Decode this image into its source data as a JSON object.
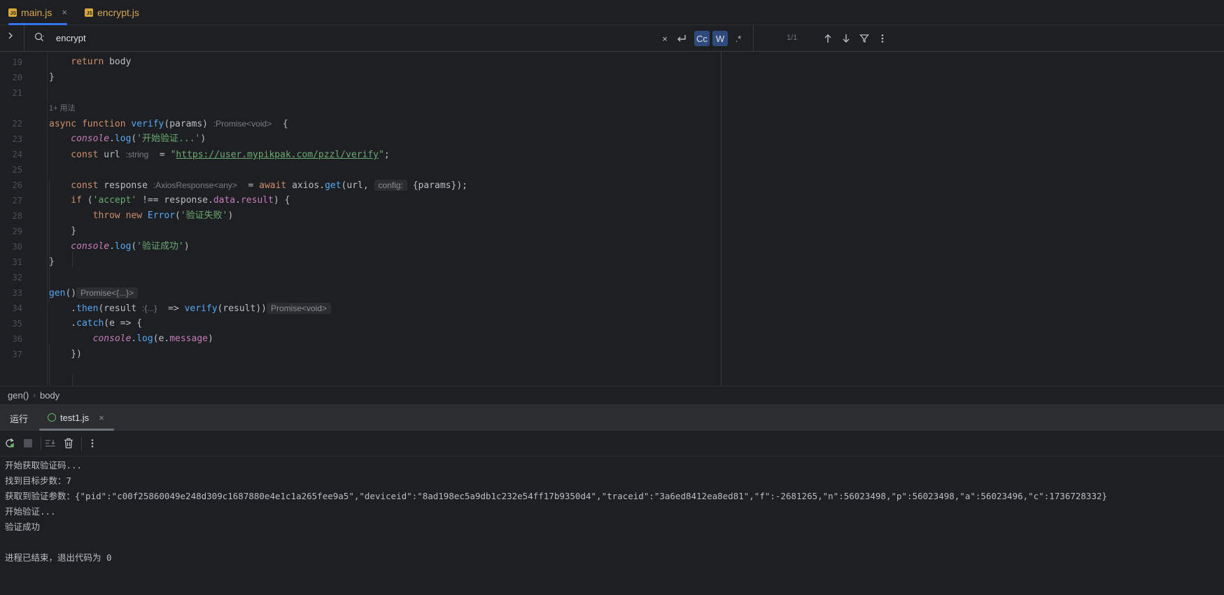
{
  "tabs": [
    {
      "label": "main.js",
      "badge": "JS",
      "close": "×"
    },
    {
      "label": "encrypt.js",
      "badge": "JS"
    }
  ],
  "find": {
    "query": "encrypt",
    "close": "×",
    "match_case_label": "Cc",
    "whole_words_label": "W",
    "regex_label": ".*",
    "match_count": "1/1"
  },
  "editor": {
    "lines": [
      {
        "n": "19",
        "segs": [
          {
            "c": "kw",
            "t": "    return "
          },
          {
            "c": "",
            "t": "body"
          }
        ]
      },
      {
        "n": "20",
        "segs": [
          {
            "c": "",
            "t": "}"
          }
        ]
      },
      {
        "n": "21",
        "segs": []
      },
      {
        "n": "",
        "usage": "1+ 用法"
      },
      {
        "n": "22",
        "segs": [
          {
            "c": "kw",
            "t": "async function "
          },
          {
            "c": "fn",
            "t": "verify"
          },
          {
            "c": "",
            "t": "(params) "
          },
          {
            "c": "hint",
            "t": ":Promise<void>"
          },
          {
            "c": "",
            "t": "  {"
          }
        ]
      },
      {
        "n": "23",
        "segs": [
          {
            "c": "it",
            "t": "    console"
          },
          {
            "c": "",
            "t": "."
          },
          {
            "c": "fn",
            "t": "log"
          },
          {
            "c": "",
            "t": "("
          },
          {
            "c": "str",
            "t": "'开始验证...'"
          },
          {
            "c": "",
            "t": ")"
          }
        ]
      },
      {
        "n": "24",
        "segs": [
          {
            "c": "kw",
            "t": "    const "
          },
          {
            "c": "",
            "t": "url "
          },
          {
            "c": "hint",
            "t": ":string"
          },
          {
            "c": "",
            "t": "  = "
          },
          {
            "c": "str",
            "t": "\""
          },
          {
            "c": "url",
            "t": "https://user.mypikpak.com/pzzl/verify"
          },
          {
            "c": "str",
            "t": "\""
          },
          {
            "c": "",
            "t": ";"
          }
        ]
      },
      {
        "n": "25",
        "segs": []
      },
      {
        "n": "26",
        "segs": [
          {
            "c": "kw",
            "t": "    const "
          },
          {
            "c": "",
            "t": "response "
          },
          {
            "c": "hint",
            "t": ":AxiosResponse<any>"
          },
          {
            "c": "",
            "t": "  = "
          },
          {
            "c": "kw",
            "t": "await "
          },
          {
            "c": "",
            "t": "axios."
          },
          {
            "c": "fn",
            "t": "get"
          },
          {
            "c": "",
            "t": "(url, "
          },
          {
            "c": "hintbox",
            "t": "config:"
          },
          {
            "c": "",
            "t": " {params});"
          }
        ]
      },
      {
        "n": "27",
        "segs": [
          {
            "c": "kw",
            "t": "    if "
          },
          {
            "c": "",
            "t": "("
          },
          {
            "c": "str",
            "t": "'accept'"
          },
          {
            "c": "",
            "t": " !== response."
          },
          {
            "c": "prop",
            "t": "data"
          },
          {
            "c": "",
            "t": "."
          },
          {
            "c": "prop",
            "t": "result"
          },
          {
            "c": "",
            "t": ") {"
          }
        ]
      },
      {
        "n": "28",
        "segs": [
          {
            "c": "kw",
            "t": "        throw new "
          },
          {
            "c": "cls",
            "t": "Error"
          },
          {
            "c": "",
            "t": "("
          },
          {
            "c": "str",
            "t": "'验证失败'"
          },
          {
            "c": "",
            "t": ")"
          }
        ]
      },
      {
        "n": "29",
        "segs": [
          {
            "c": "",
            "t": "    }"
          }
        ]
      },
      {
        "n": "30",
        "segs": [
          {
            "c": "it",
            "t": "    console"
          },
          {
            "c": "",
            "t": "."
          },
          {
            "c": "fn",
            "t": "log"
          },
          {
            "c": "",
            "t": "("
          },
          {
            "c": "str",
            "t": "'验证成功'"
          },
          {
            "c": "",
            "t": ")"
          }
        ]
      },
      {
        "n": "31",
        "segs": [
          {
            "c": "",
            "t": "}"
          }
        ]
      },
      {
        "n": "32",
        "segs": []
      },
      {
        "n": "33",
        "segs": [
          {
            "c": "fn",
            "t": "gen"
          },
          {
            "c": "",
            "t": "()"
          },
          {
            "c": "hintbox",
            "t": "Promise<{...}>"
          }
        ]
      },
      {
        "n": "34",
        "segs": [
          {
            "c": "",
            "t": "    ."
          },
          {
            "c": "fn",
            "t": "then"
          },
          {
            "c": "",
            "t": "(result "
          },
          {
            "c": "hint",
            "t": ":{...}"
          },
          {
            "c": "",
            "t": "  => "
          },
          {
            "c": "fn",
            "t": "verify"
          },
          {
            "c": "",
            "t": "(result))"
          },
          {
            "c": "hintbox",
            "t": "Promise<void>"
          }
        ]
      },
      {
        "n": "35",
        "segs": [
          {
            "c": "",
            "t": "    ."
          },
          {
            "c": "fn",
            "t": "catch"
          },
          {
            "c": "",
            "t": "(e => {"
          }
        ]
      },
      {
        "n": "36",
        "segs": [
          {
            "c": "it",
            "t": "        console"
          },
          {
            "c": "",
            "t": "."
          },
          {
            "c": "fn",
            "t": "log"
          },
          {
            "c": "",
            "t": "(e."
          },
          {
            "c": "prop",
            "t": "message"
          },
          {
            "c": "",
            "t": ")"
          }
        ]
      },
      {
        "n": "37",
        "segs": [
          {
            "c": "",
            "t": "    })"
          }
        ]
      }
    ]
  },
  "breadcrumb": {
    "items": [
      "gen()",
      "body"
    ]
  },
  "run_panel": {
    "title": "运行",
    "tab_label": "test1.js",
    "tab_close": "×",
    "console_lines": [
      "开始获取验证码...",
      "找到目标步数：7",
      "获取到验证参数：{\"pid\":\"c00f25860049e248d309c1687880e4e1c1a265fee9a5\",\"deviceid\":\"8ad198ec5a9db1c232e54ff17b9350d4\",\"traceid\":\"3a6ed8412ea8ed81\",\"f\":-2681265,\"n\":56023498,\"p\":56023498,\"a\":56023496,\"c\":1736728332}",
      "开始验证...",
      "验证成功",
      "",
      "进程已结束，退出代码为 0"
    ]
  },
  "colors": {
    "accent": "#3574f0",
    "background": "#1e1f22",
    "panel": "#2b2d30"
  }
}
